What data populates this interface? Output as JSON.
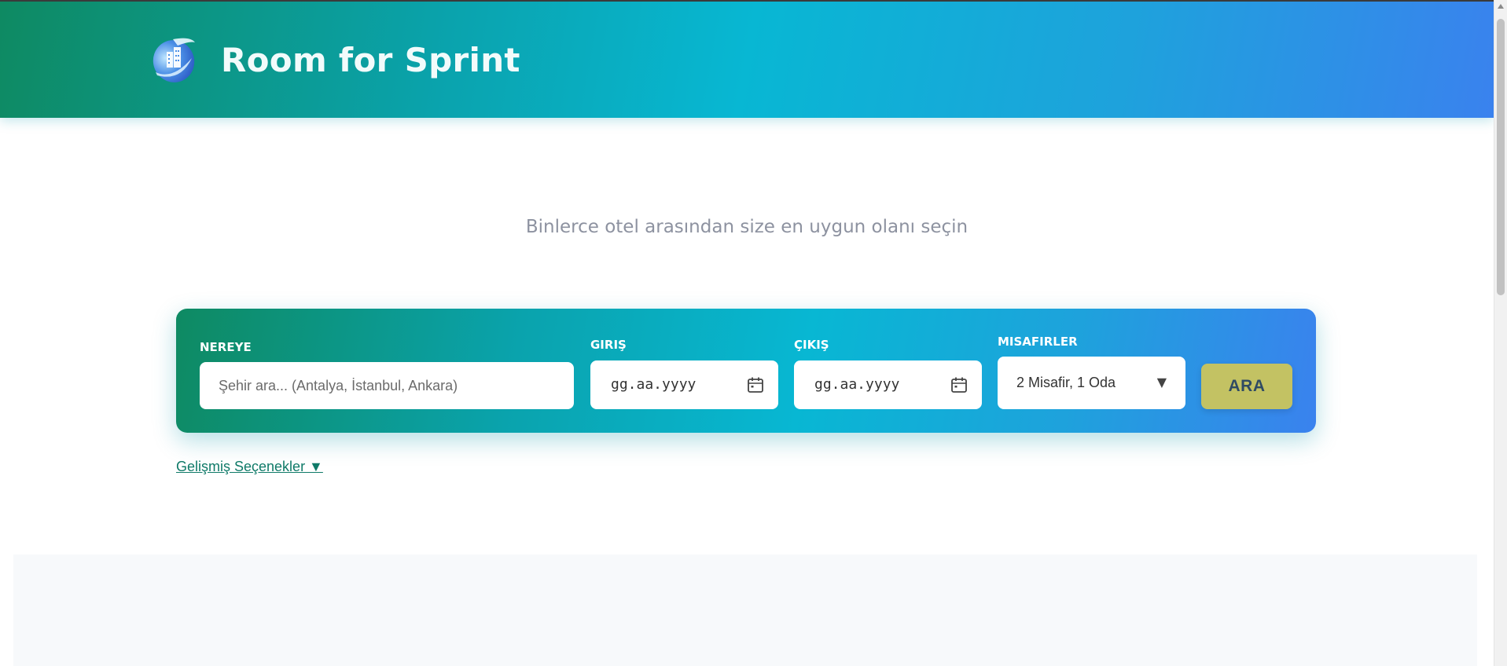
{
  "header": {
    "brand": "Room for Sprint",
    "logo_icon": "building-globe-icon"
  },
  "hero": {
    "subtitle": "Binlerce otel arasından size en uygun olanı seçin"
  },
  "search": {
    "destination": {
      "label": "NEREYE",
      "placeholder": "Şehir ara... (Antalya, İstanbul, Ankara)",
      "value": ""
    },
    "checkin": {
      "label": "GIRIŞ",
      "placeholder": "gg.aa.yyyy",
      "icon": "calendar-icon"
    },
    "checkout": {
      "label": "ÇIKIŞ",
      "placeholder": "gg.aa.yyyy",
      "icon": "calendar-icon"
    },
    "guests": {
      "label": "MISAFIRLER",
      "selected": "2 Misafir, 1 Oda",
      "caret": "▼"
    },
    "submit_label": "ARA"
  },
  "advanced": {
    "label": "Gelişmiş Seçenekler ▼"
  },
  "colors": {
    "header_gradient_start": "#0e8a62",
    "header_gradient_mid": "#08b7d3",
    "header_gradient_end": "#3a82ee",
    "search_button": "#c3c263",
    "link": "#0f7a68"
  }
}
